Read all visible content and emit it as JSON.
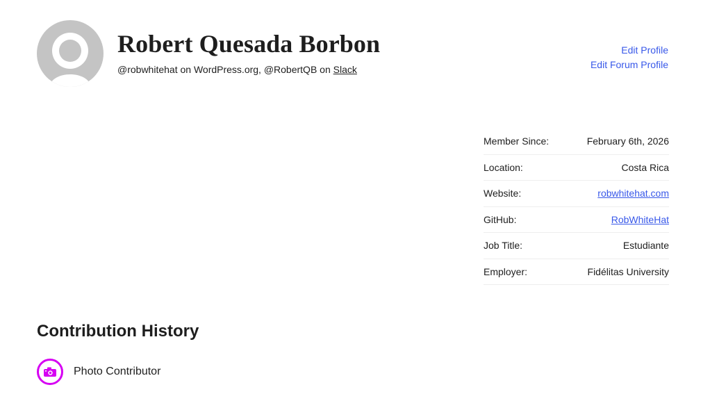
{
  "profile": {
    "name": "Robert Quesada Borbon",
    "handles_text": "@robwhitehat on WordPress.org, @RobertQB on",
    "slack_label": "Slack"
  },
  "actions": {
    "edit_profile": "Edit Profile",
    "edit_forum_profile": "Edit Forum Profile"
  },
  "meta": [
    {
      "label": "Member Since:",
      "value": "February 6th, 2026"
    },
    {
      "label": "Location:",
      "value": "Costa Rica"
    },
    {
      "label": "Website:",
      "value": "robwhitehat.com"
    },
    {
      "label": "GitHub:",
      "value": "RobWhiteHat"
    },
    {
      "label": "Job Title:",
      "value": "Estudiante"
    },
    {
      "label": "Employer:",
      "value": "Fidélitas University"
    }
  ],
  "contribution_history": {
    "title": "Contribution History",
    "items": [
      {
        "label": "Photo Contributor",
        "icon": "camera-icon",
        "color": "#d600f3"
      }
    ]
  },
  "colors": {
    "link": "#3858e9",
    "badge": "#d600f3",
    "avatar_bg": "#c4c4c4"
  }
}
